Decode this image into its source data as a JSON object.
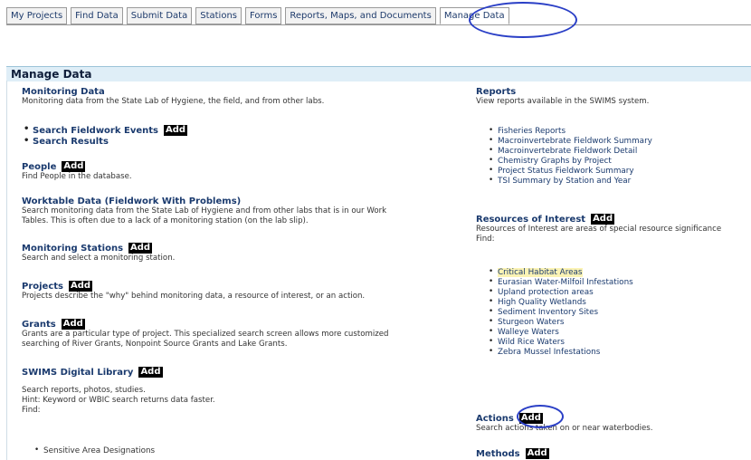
{
  "tabs": [
    {
      "label": "My Projects"
    },
    {
      "label": "Find Data"
    },
    {
      "label": "Submit Data"
    },
    {
      "label": "Stations"
    },
    {
      "label": "Forms"
    },
    {
      "label": "Reports, Maps, and Documents"
    },
    {
      "label": "Manage Data"
    }
  ],
  "panel_title": "Manage Data",
  "add_label": "Add",
  "left": {
    "monitoring": {
      "title": "Monitoring Data",
      "desc": "Monitoring data from the State Lab of Hygiene, the field, and from other labs.",
      "links": [
        "Search Fieldwork Events",
        "Search Results"
      ]
    },
    "people": {
      "title": "People",
      "desc": "Find People in the database."
    },
    "worktable": {
      "title": "Worktable Data (Fieldwork With Problems)",
      "desc1": "Search monitoring data from the State Lab of Hygiene and from other labs that is in our Work",
      "desc2": "Tables. This is often due to a lack of a monitoring station (on the lab slip)."
    },
    "stations": {
      "title": "Monitoring Stations",
      "desc": "Search and select a monitoring station."
    },
    "projects": {
      "title": "Projects",
      "desc": "Projects describe the \"why\" behind monitoring data, a resource of interest, or an action."
    },
    "grants": {
      "title": "Grants",
      "desc1": "Grants are a particular type of project. This specialized search screen allows more customized",
      "desc2": "searching of River Grants, Nonpoint Source Grants and Lake Grants."
    },
    "library": {
      "title": "SWIMS Digital Library",
      "desc1": "Search reports, photos, studies.",
      "desc2": "Hint: Keyword or WBIC search returns data faster.",
      "desc3": "Find:",
      "items": [
        "Sensitive Area Designations"
      ]
    }
  },
  "right": {
    "reports": {
      "title": "Reports",
      "desc": "View reports available in the SWIMS system.",
      "items": [
        "Fisheries Reports",
        "Macroinvertebrate Fieldwork Summary",
        "Macroinvertebrate Fieldwork Detail",
        "Chemistry Graphs by Project",
        "Project Status Fieldwork Summary",
        "TSI Summary by Station and Year"
      ]
    },
    "resources": {
      "title": "Resources of Interest",
      "desc1": "Resources of Interest are areas of special resource significance",
      "desc2": "Find:",
      "items": [
        "Critical Habitat Areas",
        "Eurasian Water-Milfoil Infestations",
        "Upland protection areas",
        "High Quality Wetlands",
        "Sediment Inventory Sites",
        "Sturgeon Waters",
        "Walleye Waters",
        "Wild Rice Waters",
        "Zebra Mussel Infestations"
      ]
    },
    "actions": {
      "title": "Actions",
      "desc": "Search actions taken on or near waterbodies."
    },
    "methods": {
      "title": "Methods"
    }
  },
  "colors": {
    "oval": "#2a3fc6",
    "header_bg": "#dfeef7",
    "link": "#1a3a6e",
    "highlight": "#fbf3b4"
  }
}
